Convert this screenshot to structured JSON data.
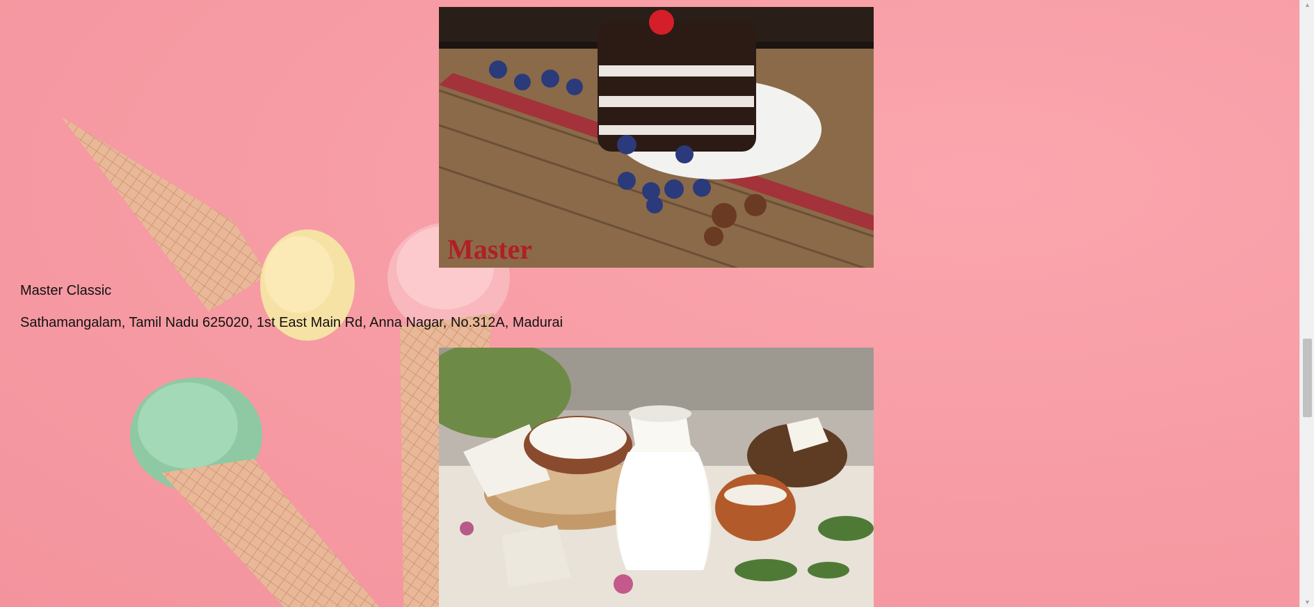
{
  "listing": {
    "shop_name": "Master Classic",
    "address": "Sathamangalam, Tamil Nadu 625020, 1st East Main Rd, Anna Nagar, No.312A, Madurai"
  },
  "images": {
    "cake": {
      "alt": "Black forest cake on wooden board",
      "watermark": "Master"
    },
    "dairy": {
      "alt": "Milk jug with cheese and curd"
    }
  },
  "scrollbar": {
    "up_arrow": "▲",
    "down_arrow": "▼"
  },
  "colors": {
    "background": "#f7a0a8",
    "scrollbar_track": "#f1f1f1",
    "scrollbar_thumb": "#c1c1c1",
    "text": "#111111"
  }
}
